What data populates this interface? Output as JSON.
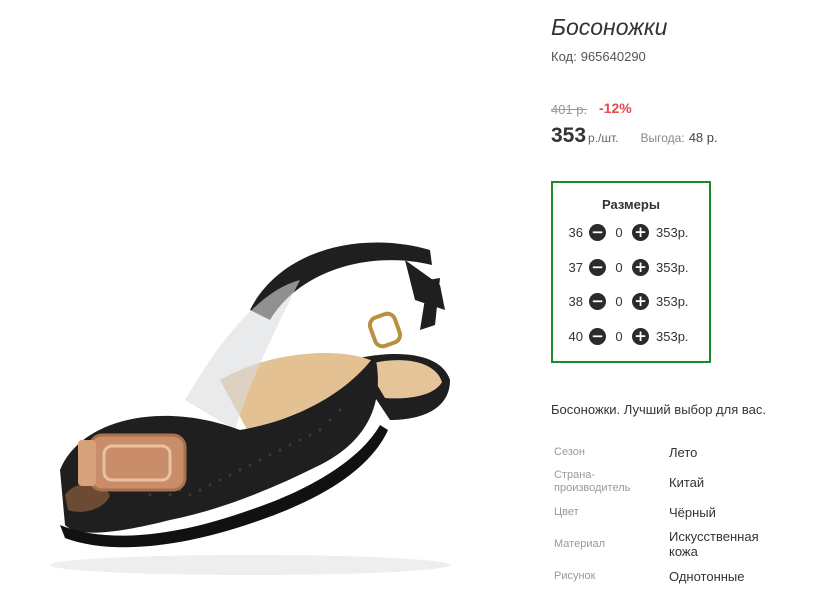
{
  "product": {
    "title": "Босоножки",
    "code_label": "Код:",
    "code_value": "965640290"
  },
  "pricing": {
    "old_price": "401 р.",
    "discount": "-12%",
    "price": "353",
    "unit": "р./шт.",
    "savings_label": "Выгода:",
    "savings_value": "48 р."
  },
  "sizes": {
    "title": "Размеры",
    "rows": [
      {
        "size": "36",
        "qty": "0",
        "price": "353р."
      },
      {
        "size": "37",
        "qty": "0",
        "price": "353р."
      },
      {
        "size": "38",
        "qty": "0",
        "price": "353р."
      },
      {
        "size": "40",
        "qty": "0",
        "price": "353р."
      }
    ],
    "minus_icon": "minus-circle-icon",
    "plus_icon": "plus-circle-icon"
  },
  "description": "Босоножки. Лучший выбор для вас.",
  "attributes": [
    {
      "label": "Сезон",
      "value": "Лето"
    },
    {
      "label": "Страна-производитель",
      "label_line1": "Страна-",
      "label_line2": "производитель",
      "value": "Китай"
    },
    {
      "label": "Цвет",
      "value": "Чёрный"
    },
    {
      "label": "Материал",
      "value": "Искусственная кожа",
      "value_line1": "Искусственная",
      "value_line2": "кожа"
    },
    {
      "label": "Рисунок",
      "value": "Однотонные"
    }
  ],
  "colors": {
    "sizes_border": "#1a8a2a",
    "discount": "#e8474c",
    "shoe": "#1f1f1f",
    "buckle": "#c98d6a"
  }
}
